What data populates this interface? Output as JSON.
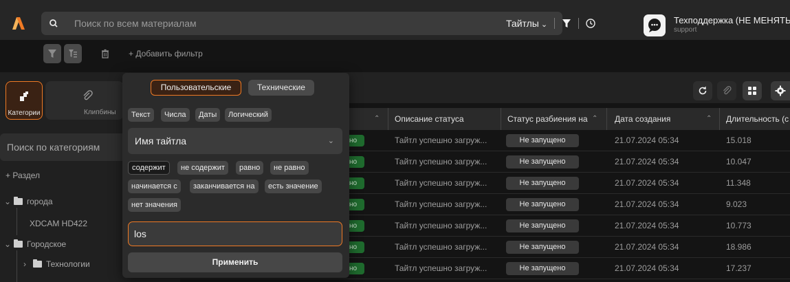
{
  "colors": {
    "accent": "#f07a24",
    "bg": "#141414",
    "panel": "#2b2b2b",
    "success": "#1f6b2e"
  },
  "header": {
    "search_placeholder": "Поиск по всем материалам",
    "scope_label": "Тайтлы",
    "support_name": "Техподдержка (НЕ МЕНЯТЬ)",
    "support_role": "support"
  },
  "filters": {
    "add_filter_label": "+ Добавить фильтр"
  },
  "sidebar": {
    "categories_label": "Категории",
    "clipbins_label": "Клипбины",
    "search_placeholder": "Поиск по категориям",
    "add_section_label": "+ Раздел",
    "tree": [
      {
        "label": "города"
      },
      {
        "label": "XDCAM HD422"
      },
      {
        "label": "Городское"
      },
      {
        "label": "Технологии"
      }
    ]
  },
  "table": {
    "headers": [
      "Описание статуса",
      "Статус разбиения на ...",
      "Дата создания",
      "Длительность (с"
    ],
    "status_partial": "но",
    "rows": [
      {
        "description": "Тайтл успешно загруж...",
        "split_status": "Не запущено",
        "created": "21.07.2024 05:34",
        "duration": "15.018"
      },
      {
        "description": "Тайтл успешно загруж...",
        "split_status": "Не запущено",
        "created": "21.07.2024 05:34",
        "duration": "10.047"
      },
      {
        "description": "Тайтл успешно загруж...",
        "split_status": "Не запущено",
        "created": "21.07.2024 05:34",
        "duration": "11.348"
      },
      {
        "description": "Тайтл успешно загруж...",
        "split_status": "Не запущено",
        "created": "21.07.2024 05:34",
        "duration": "9.023"
      },
      {
        "description": "Тайтл успешно загруж...",
        "split_status": "Не запущено",
        "created": "21.07.2024 05:34",
        "duration": "10.773"
      },
      {
        "description": "Тайтл успешно загруж...",
        "split_status": "Не запущено",
        "created": "21.07.2024 05:34",
        "duration": "18.986"
      },
      {
        "description": "Тайтл успешно загруж...",
        "split_status": "Не запущено",
        "created": "21.07.2024 05:34",
        "duration": "17.237"
      }
    ]
  },
  "popover": {
    "tabs": [
      "Пользовательские",
      "Технические"
    ],
    "types": [
      "Текст",
      "Числа",
      "Даты",
      "Логический"
    ],
    "field_value": "Имя тайтла",
    "operators": [
      "содержит",
      "не содержит",
      "равно",
      "не равно",
      "начинается с",
      "заканчивается на",
      "есть значение",
      "нет значения"
    ],
    "input_value": "los",
    "apply_label": "Применить"
  }
}
